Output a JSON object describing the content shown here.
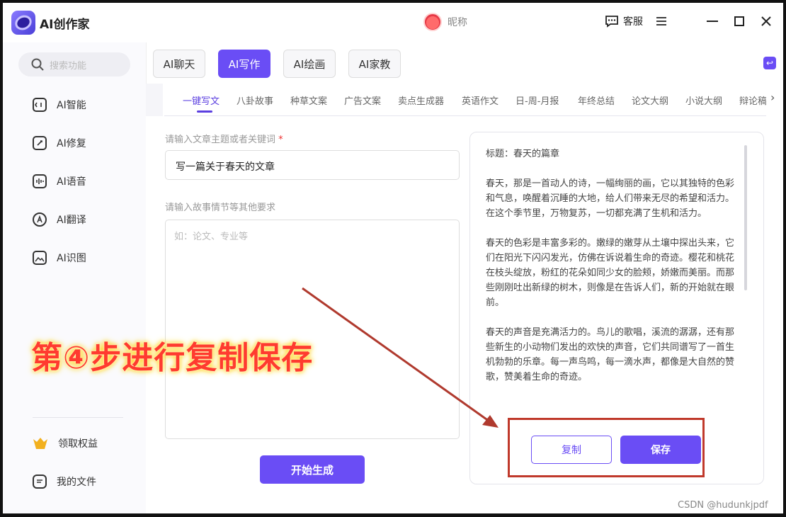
{
  "app": {
    "title": "AI创作家"
  },
  "user": {
    "name": "昵称"
  },
  "titlebar": {
    "service": "客服",
    "menu_icon": "menu-icon",
    "minimize": "—",
    "maximize": "☐",
    "close": "✕"
  },
  "sidebar": {
    "search_placeholder": "搜索功能",
    "items": [
      {
        "label": "AI智能",
        "icon": "ai-smart-icon"
      },
      {
        "label": "AI修复",
        "icon": "ai-repair-icon"
      },
      {
        "label": "AI语音",
        "icon": "ai-voice-icon"
      },
      {
        "label": "AI翻译",
        "icon": "ai-translate-icon"
      },
      {
        "label": "AI识图",
        "icon": "ai-image-icon"
      }
    ],
    "bottom": [
      {
        "label": "领取权益",
        "icon": "crown-icon"
      },
      {
        "label": "我的文件",
        "icon": "file-icon"
      }
    ]
  },
  "top_tabs": [
    "AI聊天",
    "AI写作",
    "AI绘画",
    "AI家教"
  ],
  "active_top_tab": "AI写作",
  "subtabs": [
    "一键写文",
    "八卦故事",
    "种草文案",
    "广告文案",
    "卖点生成器",
    "英语作文",
    "日-周-月报",
    "年终总结",
    "论文大纲",
    "小说大纲",
    "辩论稿"
  ],
  "form": {
    "topic_label": "请输入文章主题或者关键词",
    "topic_required": "*",
    "topic_value": "写一篇关于春天的文章",
    "detail_label": "请输入故事情节等其他要求",
    "detail_placeholder": "如：论文、专业等",
    "generate_label": "开始生成"
  },
  "result": {
    "title": "标题：春天的篇章",
    "paragraphs": [
      "春天，那是一首动人的诗，一幅绚丽的画，它以其独特的色彩和气息，唤醒着沉睡的大地，给人们带来无尽的希望和活力。在这个季节里，万物复苏，一切都充满了生机和活力。",
      "春天的色彩是丰富多彩的。嫩绿的嫩芽从土壤中探出头来，它们在阳光下闪闪发光，仿佛在诉说着生命的奇迹。樱花和桃花在枝头绽放，粉红的花朵如同少女的脸颊，娇嫩而美丽。而那些刚刚吐出新绿的树木，则像是在告诉人们，新的开始就在眼前。",
      "春天的声音是充满活力的。鸟儿的歌唱，溪流的潺潺，还有那些新生的小动物们发出的欢快的声音，它们共同谱写了一首生机勃勃的乐章。每一声鸟鸣，每一滴水声，都像是大自然的赞歌，赞美着生命的奇迹。"
    ],
    "copy_label": "复制",
    "save_label": "保存"
  },
  "annotation": {
    "text": "第④步进行复制保存",
    "color": "#ff3b2f",
    "box_color": "#c0392b"
  },
  "watermark": "CSDN @hudunkjpdf",
  "colors": {
    "accent": "#6a4df5"
  }
}
